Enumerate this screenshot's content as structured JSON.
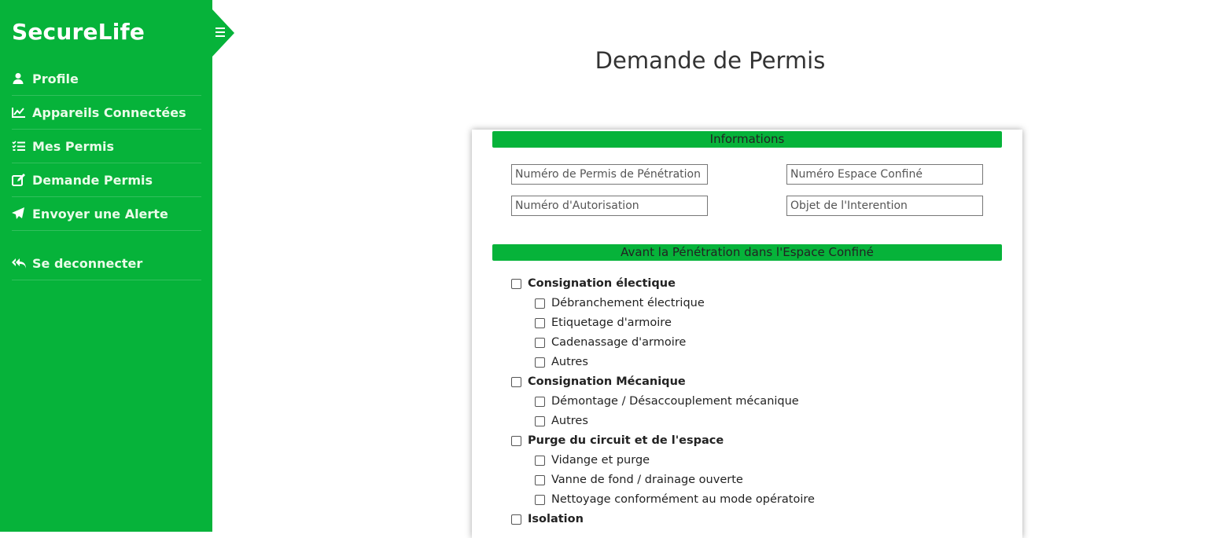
{
  "brand": "SecureLife",
  "nav": [
    {
      "label": "Profile",
      "icon": "user-icon"
    },
    {
      "label": "Appareils Connectées",
      "icon": "chart-line-icon"
    },
    {
      "label": "Mes Permis",
      "icon": "list-check-icon"
    },
    {
      "label": "Demande Permis",
      "icon": "edit-icon"
    },
    {
      "label": "Envoyer une Alerte",
      "icon": "paper-plane-icon"
    }
  ],
  "logout": {
    "label": "Se deconnecter",
    "icon": "reply-all-icon"
  },
  "page_title": "Demande de Permis",
  "sections": {
    "informations": "Informations",
    "avant": "Avant la Pénétration dans l'Espace Confiné"
  },
  "fields": {
    "num_permis": "Numéro de Permis de Pénétration",
    "num_espace": "Numéro Espace Confiné",
    "num_autorisation": "Numéro d'Autorisation",
    "objet": "Objet de l'Interention"
  },
  "checklist": [
    {
      "label": "Consignation électique",
      "items": [
        "Débranchement électrique",
        "Etiquetage d'armoire",
        "Cadenassage d'armoire",
        "Autres"
      ]
    },
    {
      "label": "Consignation Mécanique",
      "items": [
        "Démontage / Désaccouplement mécanique",
        "Autres"
      ]
    },
    {
      "label": "Purge du circuit et de l'espace",
      "items": [
        "Vidange et purge",
        "Vanne de fond / drainage ouverte",
        "Nettoyage conformément au mode opératoire"
      ]
    },
    {
      "label": "Isolation",
      "items": []
    }
  ],
  "colors": {
    "accent": "#06b33a"
  }
}
